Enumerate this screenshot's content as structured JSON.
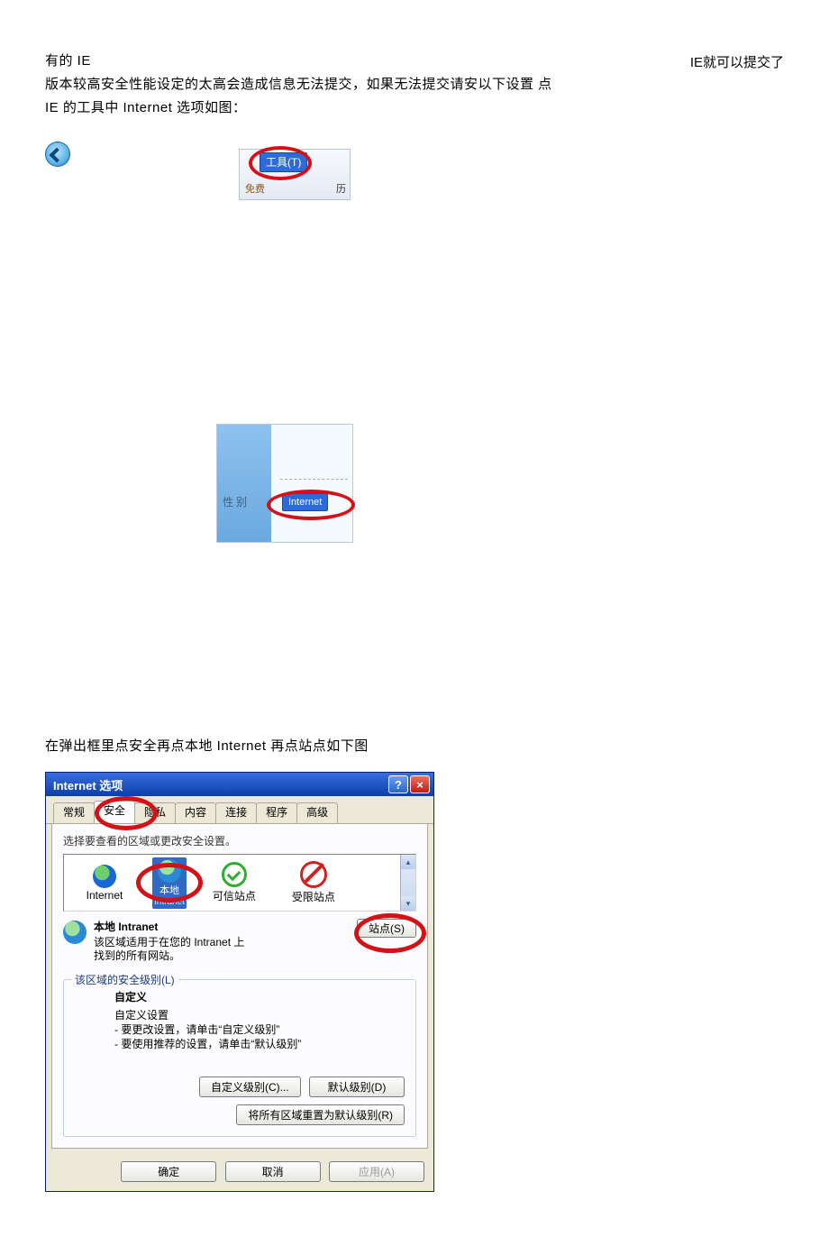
{
  "intro": {
    "top_right": "IE就可以提交了",
    "line1": "有的  IE",
    "line2": "版本较高安全性能设定的太高会造成信息无法提交，如果无法提交请安以下设置  点",
    "line3": "IE 的工具中  Internet 选项如图："
  },
  "toolbar_snippet": {
    "tools_button": "工具(T)",
    "free_label": "免费",
    "history_label": "历"
  },
  "submenu_snippet": {
    "left_label": "性  别",
    "internet_item": "Internet"
  },
  "para2": "在弹出框里点安全再点本地  Internet 再点站点如下图",
  "dialog": {
    "title": "Internet 选项",
    "help_btn": "?",
    "close_btn": "×",
    "tabs": [
      "常规",
      "安全",
      "隐私",
      "内容",
      "连接",
      "程序",
      "高级"
    ],
    "active_tab_index": 1,
    "zone_instruction": "选择要查看的区域或更改安全设置。",
    "zones": {
      "internet": "Internet",
      "local": "本地",
      "local_sub": "Intranet",
      "trusted": "可信站点",
      "restricted": "受限站点"
    },
    "scroll_up": "▴",
    "scroll_down": "▾",
    "desc_title": "本地 Intranet",
    "desc_body1": "该区域适用于在您的 Intranet 上",
    "desc_body2": "找到的所有网站。",
    "sites_button": "站点(S)",
    "group_legend": "该区域的安全级别(L)",
    "level_title": "自定义",
    "level_line1": "自定义设置",
    "level_line2": "- 要更改设置，请单击“自定义级别”",
    "level_line3": "- 要使用推荐的设置，请单击“默认级别”",
    "custom_level_btn": "自定义级别(C)...",
    "default_level_btn": "默认级别(D)",
    "reset_btn": "将所有区域重置为默认级别(R)",
    "ok_btn": "确定",
    "cancel_btn": "取消",
    "apply_btn": "应用(A)"
  }
}
